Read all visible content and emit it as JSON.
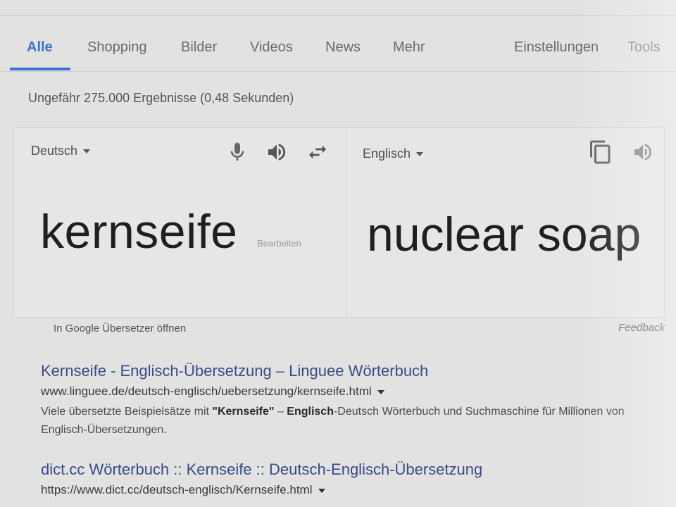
{
  "tabs": [
    {
      "label": "Alle",
      "active": true
    },
    {
      "label": "Shopping"
    },
    {
      "label": "Bilder"
    },
    {
      "label": "Videos"
    },
    {
      "label": "News"
    },
    {
      "label": "Mehr"
    }
  ],
  "tools": {
    "settings": "Einstellungen",
    "tools": "Tools"
  },
  "result_stats": "Ungefähr 275.000 Ergebnisse (0,48 Sekunden)",
  "translator": {
    "source_lang": "Deutsch",
    "target_lang": "Englisch",
    "source_text": "kernseife",
    "edit_label": "Bearbeiten",
    "target_text": "nuclear soap",
    "open_link": "In Google Übersetzer öffnen",
    "feedback": "Feedback",
    "icons": [
      "microphone-icon",
      "speaker-icon",
      "swap-icon",
      "copy-icon",
      "speaker-icon"
    ]
  },
  "results": [
    {
      "title": "Kernseife - Englisch-Übersetzung – Linguee Wörterbuch",
      "url": "www.linguee.de/deutsch-englisch/uebersetzung/kernseife.html",
      "snippet": {
        "p1": "Viele übersetzte Beispielsätze mit ",
        "b1": "\"Kernseife\"",
        "p2": " – ",
        "b2": "Englisch",
        "p3": "-Deutsch Wörterbuch und Suchmaschine für Millionen von Englisch-Übersetzungen."
      }
    },
    {
      "title": "dict.cc Wörterbuch :: Kernseife :: Deutsch-Englisch-Übersetzung",
      "url": "https://www.dict.cc/deutsch-englisch/Kernseife.html"
    }
  ],
  "colors": {
    "accent": "#3e72cf",
    "link": "#3a4a8a",
    "background": "#e2e3e0"
  }
}
